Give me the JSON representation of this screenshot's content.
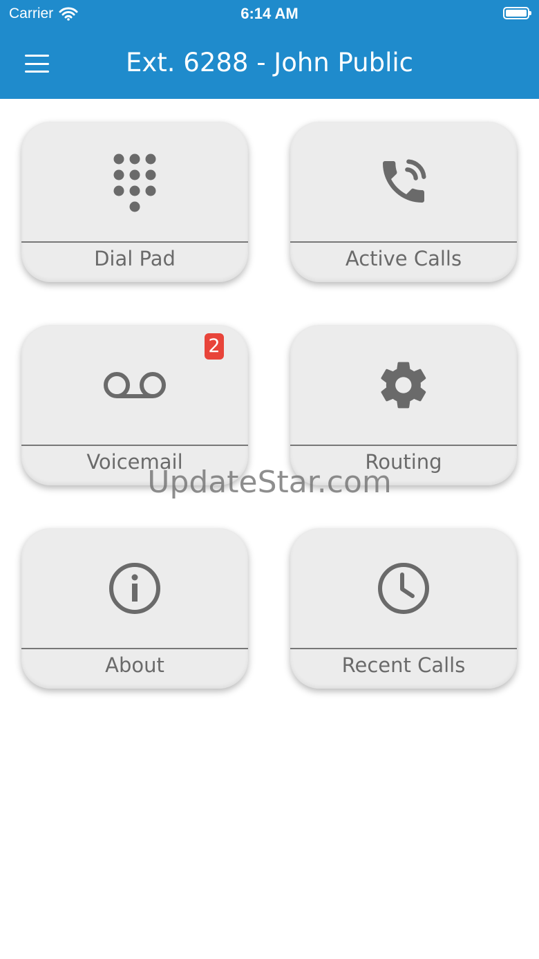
{
  "status_bar": {
    "carrier": "Carrier",
    "time": "6:14 AM"
  },
  "header": {
    "title": "Ext. 6288 - John Public"
  },
  "tiles": [
    {
      "label": "Dial Pad",
      "icon": "dialpad-icon"
    },
    {
      "label": "Active Calls",
      "icon": "phone-call-icon"
    },
    {
      "label": "Voicemail",
      "icon": "voicemail-icon",
      "badge": "2"
    },
    {
      "label": "Routing",
      "icon": "gear-icon"
    },
    {
      "label": "About",
      "icon": "info-icon"
    },
    {
      "label": "Recent Calls",
      "icon": "clock-icon"
    }
  ],
  "watermark": "UpdateStar.com",
  "colors": {
    "header": "#1f8bcc",
    "tile": "#ececec",
    "icon": "#6a6a6a",
    "badge": "#e8443a"
  }
}
